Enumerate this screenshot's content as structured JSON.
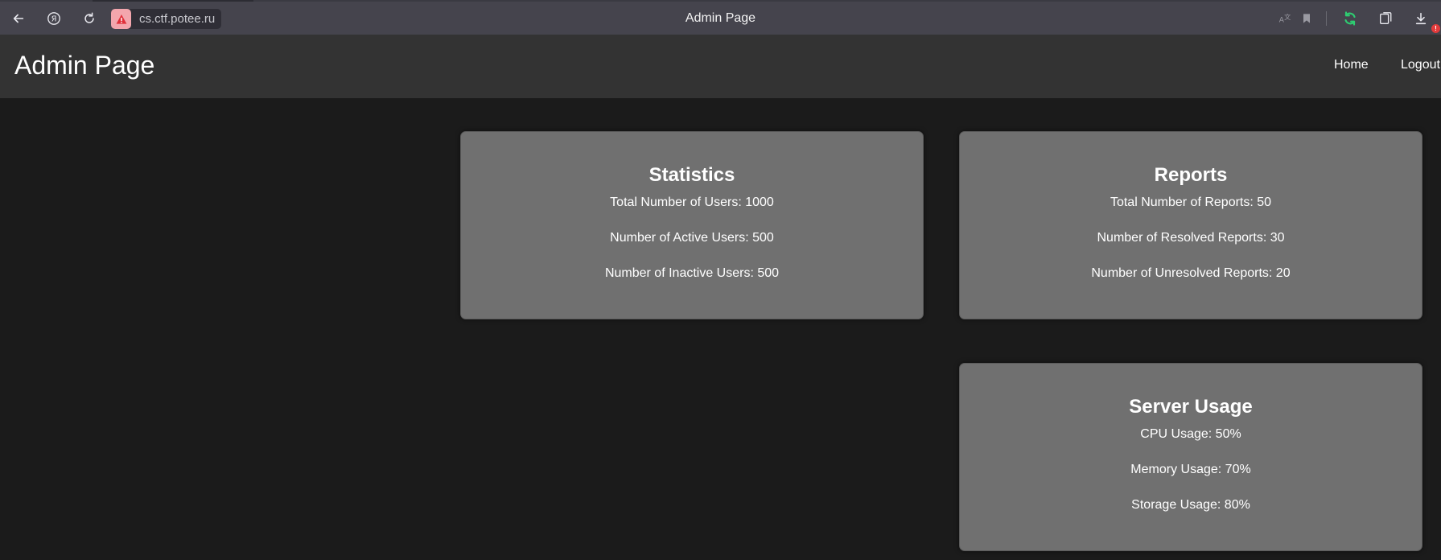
{
  "browser": {
    "url": "cs.ctf.potee.ru",
    "tab_title": "Admin Page",
    "download_badge": "!"
  },
  "header": {
    "title": "Admin Page",
    "nav": [
      "Home",
      "Logout"
    ]
  },
  "cards": {
    "statistics": {
      "title": "Statistics",
      "lines": [
        "Total Number of Users: 1000",
        "Number of Active Users: 500",
        "Number of Inactive Users: 500"
      ]
    },
    "reports": {
      "title": "Reports",
      "lines": [
        "Total Number of Reports: 50",
        "Number of Resolved Reports: 30",
        "Number of Unresolved Reports: 20"
      ]
    },
    "server_usage": {
      "title": "Server Usage",
      "lines": [
        "CPU Usage: 50%",
        "Memory Usage: 70%",
        "Storage Usage: 80%"
      ]
    }
  },
  "colors": {
    "page_bg": "#1b1b1b",
    "header_bg": "#333333",
    "card_bg": "#707070",
    "browser_bar": "#45444d",
    "sync_green": "#2ecc71",
    "warning_red": "#e0303a"
  }
}
